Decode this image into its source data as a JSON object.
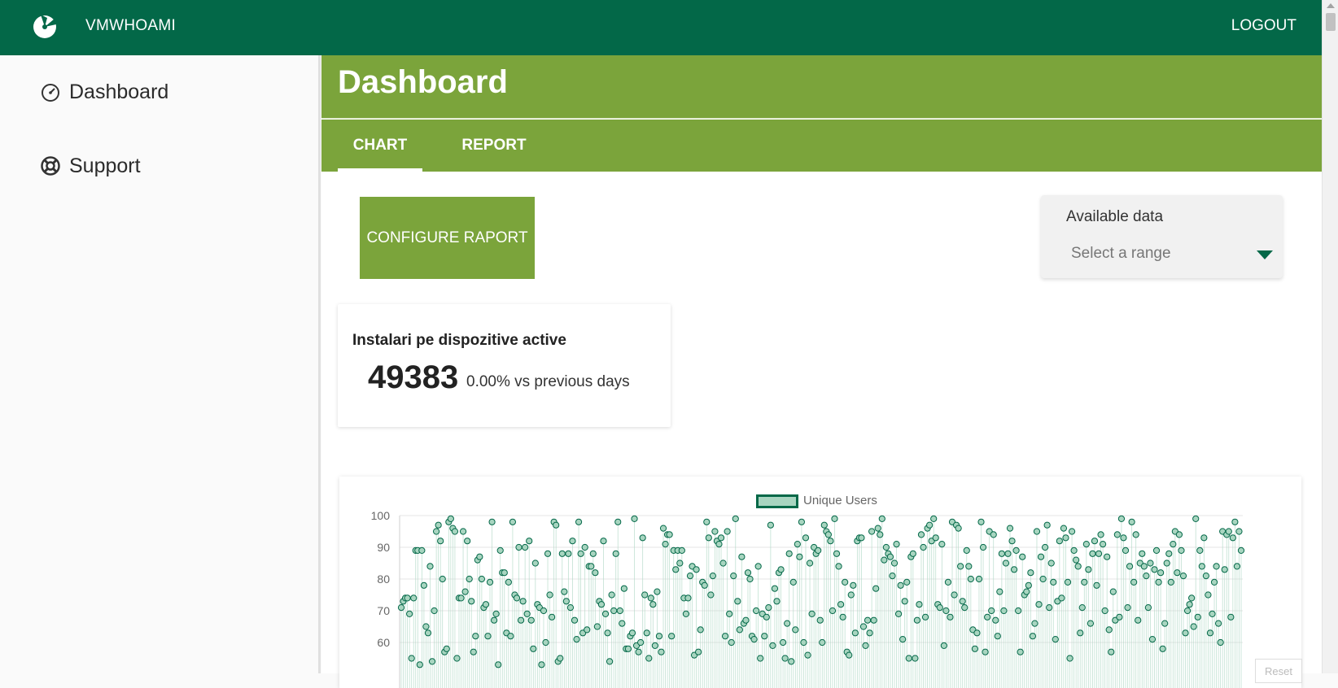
{
  "app": {
    "title": "VMWHOAMI",
    "logout_label": "LOGOUT"
  },
  "sidebar": {
    "items": [
      {
        "label": "Dashboard",
        "icon": "speedometer-icon"
      },
      {
        "label": "Support",
        "icon": "lifebuoy-icon"
      }
    ]
  },
  "page": {
    "title": "Dashboard"
  },
  "tabs": [
    {
      "label": "CHART",
      "active": true
    },
    {
      "label": "REPORT",
      "active": false
    }
  ],
  "configure_button": {
    "label": "CONFIGURE RAPORT"
  },
  "range_select": {
    "label": "Available data",
    "placeholder": "Select a range"
  },
  "stat": {
    "title": "Instalari pe dispozitive active",
    "value": "49383",
    "delta": "0.00% vs previous days"
  },
  "colors": {
    "brand_dark": "#036848",
    "accent": "#7ba43b",
    "point_fill": "#a8d5c0"
  },
  "chart_data": {
    "type": "scatter",
    "legend": [
      "Unique Users"
    ],
    "legend_position": "top",
    "yticks": [
      100,
      90,
      80,
      70,
      60
    ],
    "ylim_visible": [
      55,
      100
    ],
    "grid": true,
    "series": [
      {
        "name": "Unique Users",
        "values": [
          71,
          73,
          74,
          74,
          69,
          55,
          74,
          89,
          89,
          53,
          89,
          78,
          65,
          63,
          84,
          54,
          70,
          95,
          97,
          92,
          80,
          57,
          58,
          98,
          99,
          96,
          95,
          55,
          74,
          74,
          95,
          76,
          92,
          80,
          73,
          57,
          62,
          86,
          87,
          80,
          71,
          72,
          62,
          79,
          98,
          67,
          69,
          53,
          89,
          82,
          82,
          63,
          79,
          62,
          98,
          75,
          74,
          90,
          67,
          73,
          90,
          69,
          92,
          67,
          58,
          85,
          72,
          71,
          53,
          70,
          60,
          88,
          75,
          68,
          98,
          97,
          54,
          55,
          88,
          76,
          73,
          88,
          71,
          92,
          67,
          61,
          98,
          88,
          63,
          90,
          64,
          84,
          84,
          88,
          82,
          65,
          73,
          72,
          92,
          69,
          63,
          54,
          75,
          70,
          88,
          98,
          70,
          66,
          77,
          58,
          58,
          62,
          63,
          99,
          59,
          57,
          60,
          93,
          75,
          63,
          55,
          74,
          72,
          59,
          76,
          62,
          57,
          96,
          91,
          94,
          94,
          62,
          89,
          83,
          89,
          85,
          89,
          74,
          69,
          74,
          81,
          84,
          56,
          83,
          57,
          64,
          79,
          78,
          98,
          93,
          75,
          81,
          95,
          92,
          91,
          93,
          85,
          62,
          95,
          69,
          60,
          81,
          99,
          73,
          64,
          87,
          66,
          67,
          82,
          80,
          62,
          61,
          70,
          84,
          55,
          69,
          62,
          68,
          71,
          97,
          59,
          77,
          73,
          82,
          83,
          60,
          55,
          66,
          88,
          54,
          79,
          64,
          91,
          87,
          98,
          60,
          93,
          56,
          85,
          69,
          90,
          88,
          89,
          67,
          60,
          97,
          95,
          94,
          92,
          70,
          99,
          88,
          84,
          72,
          68,
          79,
          57,
          56,
          75,
          78,
          63,
          92,
          93,
          93,
          65,
          59,
          67,
          63,
          95,
          67,
          77,
          96,
          94,
          99,
          86,
          90,
          88,
          87,
          81,
          85,
          91,
          69,
          78,
          61,
          73,
          79,
          55,
          87,
          88,
          55,
          67,
          72,
          94,
          90,
          68,
          96,
          97,
          92,
          99,
          93,
          72,
          71,
          91,
          59,
          70,
          79,
          68,
          98,
          75,
          97,
          96,
          84,
          73,
          71,
          89,
          84,
          80,
          64,
          58,
          63,
          80,
          98,
          90,
          57,
          68,
          95,
          70,
          94,
          67,
          62,
          76,
          88,
          70,
          85,
          88,
          96,
          92,
          83,
          89,
          70,
          57,
          87,
          75,
          76,
          78,
          82,
          62,
          66,
          95,
          72,
          87,
          80,
          90,
          97,
          71,
          85,
          79,
          61,
          73,
          92,
          74,
          96,
          93,
          79,
          55,
          95,
          89,
          86,
          84,
          63,
          71,
          79,
          91,
          83,
          66,
          88,
          92,
          78,
          88,
          94,
          91,
          70,
          87,
          64,
          57,
          76,
          67,
          94,
          68,
          99,
          93,
          89,
          71,
          84,
          98,
          79,
          94,
          67,
          85,
          88,
          84,
          81,
          71,
          85,
          61,
          83,
          89,
          79,
          82,
          58,
          66,
          85,
          88,
          79,
          91,
          95,
          82,
          94,
          89,
          81,
          63,
          70,
          72,
          74,
          65,
          99,
          68,
          89,
          84,
          93,
          81,
          75,
          63,
          69,
          79,
          84,
          66,
          60,
          95,
          83,
          94,
          95,
          68,
          93,
          98,
          84,
          95,
          89
        ]
      }
    ]
  }
}
